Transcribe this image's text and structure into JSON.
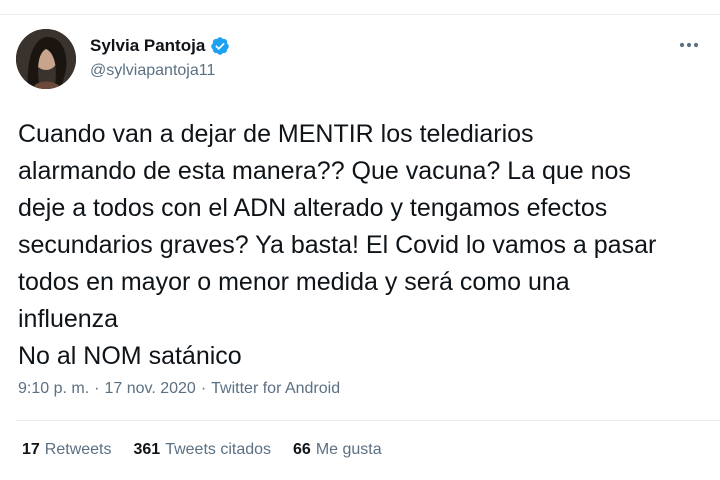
{
  "author": {
    "display_name": "Sylvia Pantoja",
    "handle": "@sylviapantoja11",
    "verified": true
  },
  "icons": {
    "verified": "verified-badge-icon",
    "more": "more-options-icon"
  },
  "tweet": {
    "text": "Cuando van a dejar de MENTIR los telediarios\nalarmando de esta manera?? Que vacuna? La que nos\ndeje a todos con el ADN alterado y tengamos efectos\nsecundarios graves? Ya basta! El Covid lo vamos a pasar\ntodos en mayor o menor medida y será como una\ninfluenza\n No al NOM satánico",
    "time": "9:10 p. m.",
    "separator": "·",
    "date": "17 nov. 2020",
    "source": "Twitter for Android"
  },
  "stats": [
    {
      "count": "17",
      "label": "Retweets"
    },
    {
      "count": "361",
      "label": "Tweets citados"
    },
    {
      "count": "66",
      "label": "Me gusta"
    }
  ],
  "colors": {
    "text": "#0f1419",
    "secondary": "#5b7083",
    "accent": "#1da1f2",
    "divider": "#e6ecf0"
  }
}
